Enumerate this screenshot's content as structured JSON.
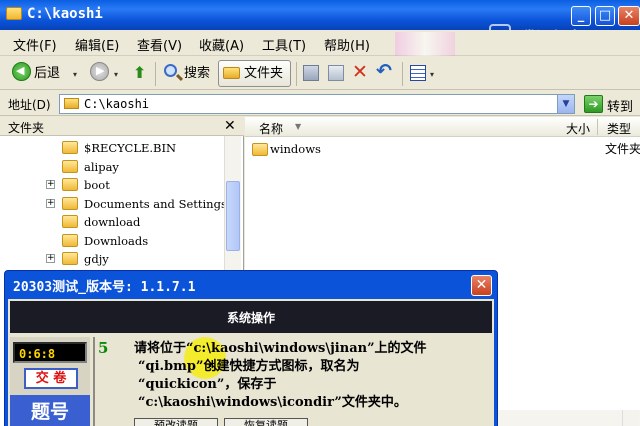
{
  "window": {
    "title": "C:\\kaoshi",
    "min_glyph": "_",
    "max_glyph": "□",
    "close_glyph": "✕",
    "watermark": "腾讯视频"
  },
  "menu": [
    "文件(F)",
    "编辑(E)",
    "查看(V)",
    "收藏(A)",
    "工具(T)",
    "帮助(H)"
  ],
  "toolbar": {
    "back_label": "后退",
    "search_label": "搜索",
    "folders_label": "文件夹",
    "dropdown_glyph": "▾",
    "up_glyph": "⬆",
    "delete_glyph": "✕",
    "undo_glyph": "↶"
  },
  "address": {
    "label": "地址(D)",
    "value": "C:\\kaoshi",
    "dd_glyph": "▼",
    "go_glyph": "➔",
    "go_label": "转到"
  },
  "tree": {
    "title": "文件夹",
    "close_glyph": "✕",
    "items": [
      {
        "label": "$RECYCLE.BIN",
        "expandable": false
      },
      {
        "label": "alipay",
        "expandable": false
      },
      {
        "label": "boot",
        "expandable": true
      },
      {
        "label": "Documents and Settings",
        "expandable": true
      },
      {
        "label": "download",
        "expandable": false
      },
      {
        "label": "Downloads",
        "expandable": false
      },
      {
        "label": "gdjy",
        "expandable": true
      }
    ]
  },
  "filelist": {
    "col_name": "名称",
    "col_size": "大小",
    "col_type": "类型",
    "sort_glyph": "▼",
    "files": [
      {
        "name": "windows",
        "type": "文件夹"
      }
    ]
  },
  "dialog": {
    "title": "20303测试_版本号: 1.1.7.1",
    "close_glyph": "✕",
    "header": "系统操作",
    "timer": "0:6:8",
    "submit_label": "交 卷",
    "qnum_label": "题号",
    "question_number": "5",
    "question_lines": [
      "请将位于“c:\\kaoshi\\windows\\jinan”上的文件",
      "“qi.bmp”创建快捷方式图标，取名为",
      "“quickicon”，保存于",
      "“c:\\kaoshi\\windows\\icondir”文件夹中。"
    ],
    "btn_a": "预改读题",
    "btn_b": "恢复读题"
  }
}
